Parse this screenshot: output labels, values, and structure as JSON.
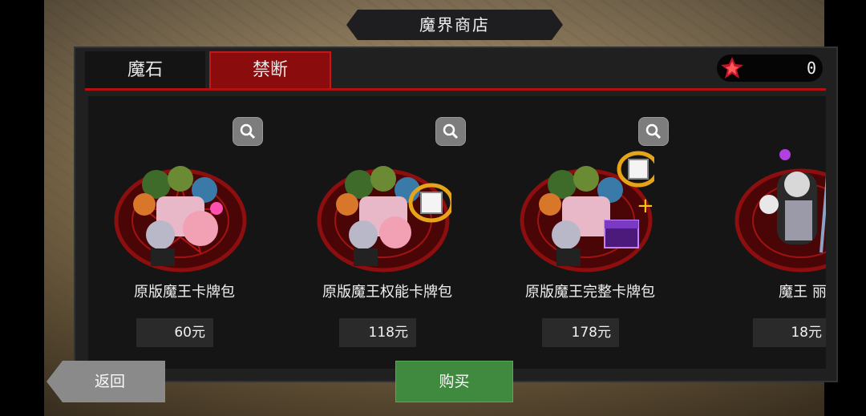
{
  "title": "魔界商店",
  "tabs": [
    {
      "label": "魔石",
      "active": false
    },
    {
      "label": "禁断",
      "active": true
    }
  ],
  "currency": {
    "icon": "red-gem-icon",
    "value": "0"
  },
  "products": [
    {
      "name": "原版魔王卡牌包",
      "price": "60元"
    },
    {
      "name": "原版魔王权能卡牌包",
      "price": "118元"
    },
    {
      "name": "原版魔王完整卡牌包",
      "price": "178元"
    },
    {
      "name": "魔王 丽贝卡",
      "price": "18元"
    }
  ],
  "buttons": {
    "back": "返回",
    "buy": "购买"
  },
  "colors": {
    "tab_active": "#8b0c0c",
    "accent_red": "#b51010",
    "buy_green": "#3f8a3f"
  }
}
